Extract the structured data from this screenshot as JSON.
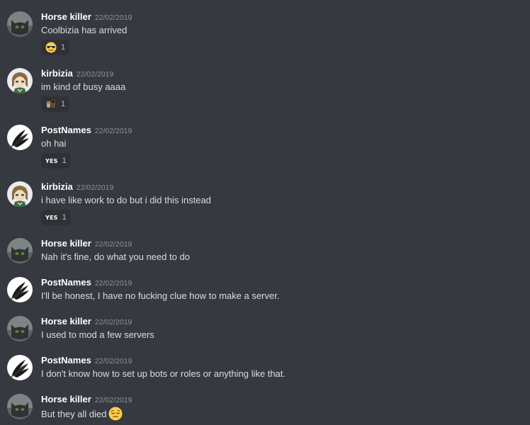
{
  "messages": [
    {
      "author": "Horse killer",
      "timestamp": "22/02/2019",
      "avatar": "cat-avatar",
      "content": "Coolbizia has arrived",
      "reaction": {
        "emoji": "sunglasses-emoji",
        "count": "1"
      }
    },
    {
      "author": "kirbizia",
      "timestamp": "22/02/2019",
      "avatar": "anime-avatar",
      "content": "im kind of busy aaaa",
      "reaction": {
        "emoji": "emote-emoji",
        "count": "1"
      }
    },
    {
      "author": "PostNames",
      "timestamp": "22/02/2019",
      "avatar": "feather-avatar",
      "content": "oh hai",
      "reaction": {
        "emoji": "yes-emoji",
        "label": "YES",
        "count": "1"
      }
    },
    {
      "author": "kirbizia",
      "timestamp": "22/02/2019",
      "avatar": "anime-avatar",
      "content": "i have like work to do but i did this instead",
      "reaction": {
        "emoji": "yes-emoji",
        "label": "YES",
        "count": "1"
      }
    },
    {
      "author": "Horse killer",
      "timestamp": "22/02/2019",
      "avatar": "cat-avatar",
      "content": "Nah it's fine, do what you need to do"
    },
    {
      "author": "PostNames",
      "timestamp": "22/02/2019",
      "avatar": "feather-avatar",
      "content": "I'll be honest, I have no fucking clue how to make a server."
    },
    {
      "author": "Horse killer",
      "timestamp": "22/02/2019",
      "avatar": "cat-avatar",
      "content": "I used to mod a few servers"
    },
    {
      "author": "PostNames",
      "timestamp": "22/02/2019",
      "avatar": "feather-avatar",
      "content": "I don't know how to set up bots or roles or anything like that."
    },
    {
      "author": "Horse killer",
      "timestamp": "22/02/2019",
      "avatar": "cat-avatar",
      "content": "But they all died",
      "inline_emoji": "pensive-emoji"
    }
  ],
  "colors": {
    "background": "#36393f",
    "author": "#ffffff",
    "text": "#dcddde",
    "timestamp": "#8e9297",
    "reaction_bg": "#2f3136"
  }
}
